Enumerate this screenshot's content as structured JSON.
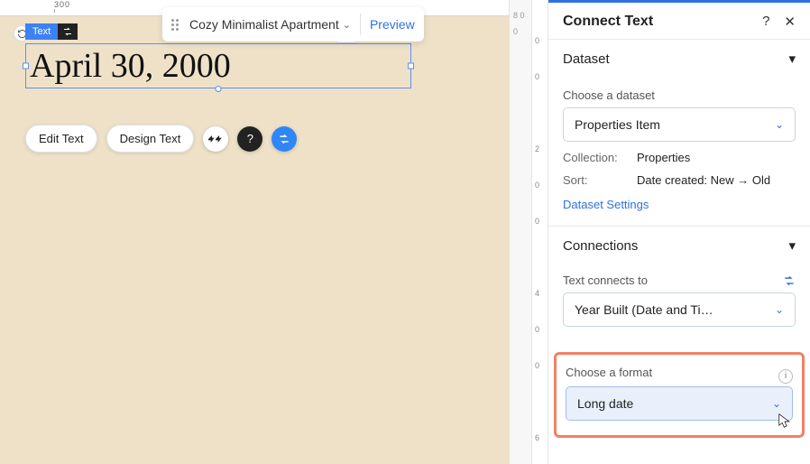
{
  "topbar": {
    "page_name": "Cozy Minimalist Apartment",
    "preview_label": "Preview"
  },
  "selection": {
    "tag_label": "Text",
    "value": "April 30, 2000"
  },
  "action_bar": {
    "edit_label": "Edit Text",
    "design_label": "Design Text"
  },
  "rulers": {
    "top_mark": "300",
    "right_marks": [
      "0",
      "0",
      "2",
      "0",
      "0",
      "4",
      "0",
      "0",
      "6"
    ],
    "gutter_marks": [
      "8 0",
      "0",
      "",
      ""
    ]
  },
  "panel": {
    "title": "Connect Text",
    "help_glyph": "?",
    "close_glyph": "✕",
    "dataset": {
      "section_label": "Dataset",
      "choose_label": "Choose a dataset",
      "value": "Properties Item",
      "collection_k": "Collection:",
      "collection_v": "Properties",
      "sort_k": "Sort:",
      "sort_v": "Date created: New → Old",
      "settings_link": "Dataset Settings"
    },
    "connections": {
      "section_label": "Connections",
      "connects_label": "Text connects to",
      "value": "Year Built (Date and Ti…"
    },
    "format": {
      "choose_label": "Choose a format",
      "value": "Long date"
    }
  }
}
